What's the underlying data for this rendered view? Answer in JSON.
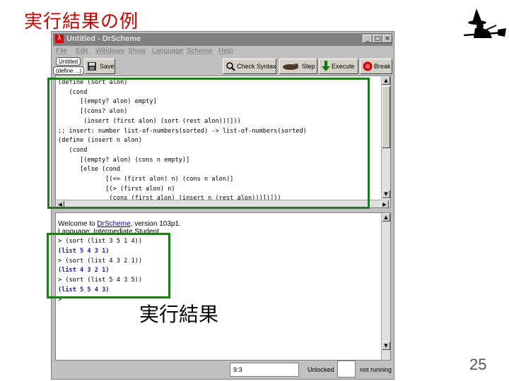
{
  "slide": {
    "title": "実行結果の例",
    "caption": "実行結果",
    "page_number": "25",
    "accent_color": "#d40000",
    "highlight_color": "#1f7a1f"
  },
  "window": {
    "title": "Untitled - DrScheme",
    "minimize_icon": "_",
    "maximize_icon": "□",
    "close_icon": "×"
  },
  "menu": {
    "items": [
      "File",
      "Edit",
      "Windows",
      "Show",
      "Language",
      "Scheme",
      "Help"
    ]
  },
  "toolbar": {
    "untitled_label": "Untitled",
    "define_label": "(define ...)",
    "save_label": "Save",
    "check_syntax_label": "Check Syntax",
    "step_label": "Step",
    "execute_label": "Execute",
    "break_label": "Break"
  },
  "definitions": {
    "code": "(define (sort alon)\n   (cond\n      [(empty? alon) empty]\n      [(cons? alon)\n       (insert (first alon) (sort (rest alon)))]))\n;; insert: number list-of-numbers(sorted) -> list-of-numbers(sorted)\n(define (insert n alon)\n   (cond\n      [(empty? alon) (cons n empty)]\n      [else (cond\n             [(<= (first alon) n) (cons n alon)]\n             [(> (first alon) n)\n              (cons (first alon) (insert n (rest alon)))])]))"
  },
  "interactions": {
    "welcome_prefix": "Welcome to ",
    "welcome_link": "DrScheme",
    "welcome_suffix": ", version 103p1.",
    "language_line": "Language: Intermediate Student.",
    "lines": [
      {
        "kind": "in",
        "text": "> (sort (list 3 5 1 4))"
      },
      {
        "kind": "out",
        "text": "(list 5 4 3 1)"
      },
      {
        "kind": "in",
        "text": "> (sort (list 4 3 2 1))"
      },
      {
        "kind": "out",
        "text": "(list 4 3 2 1)"
      },
      {
        "kind": "in",
        "text": "> (sort (list 5 4 3 5))"
      },
      {
        "kind": "out",
        "text": "(list 5 5 4 3)"
      },
      {
        "kind": "in",
        "text": ">"
      }
    ]
  },
  "status": {
    "position": "9:3",
    "lock_state": "Unlocked",
    "run_state": "not running"
  },
  "scroll": {
    "up_icon": "▲",
    "down_icon": "▼",
    "left_icon": "◀",
    "right_icon": "▶"
  }
}
